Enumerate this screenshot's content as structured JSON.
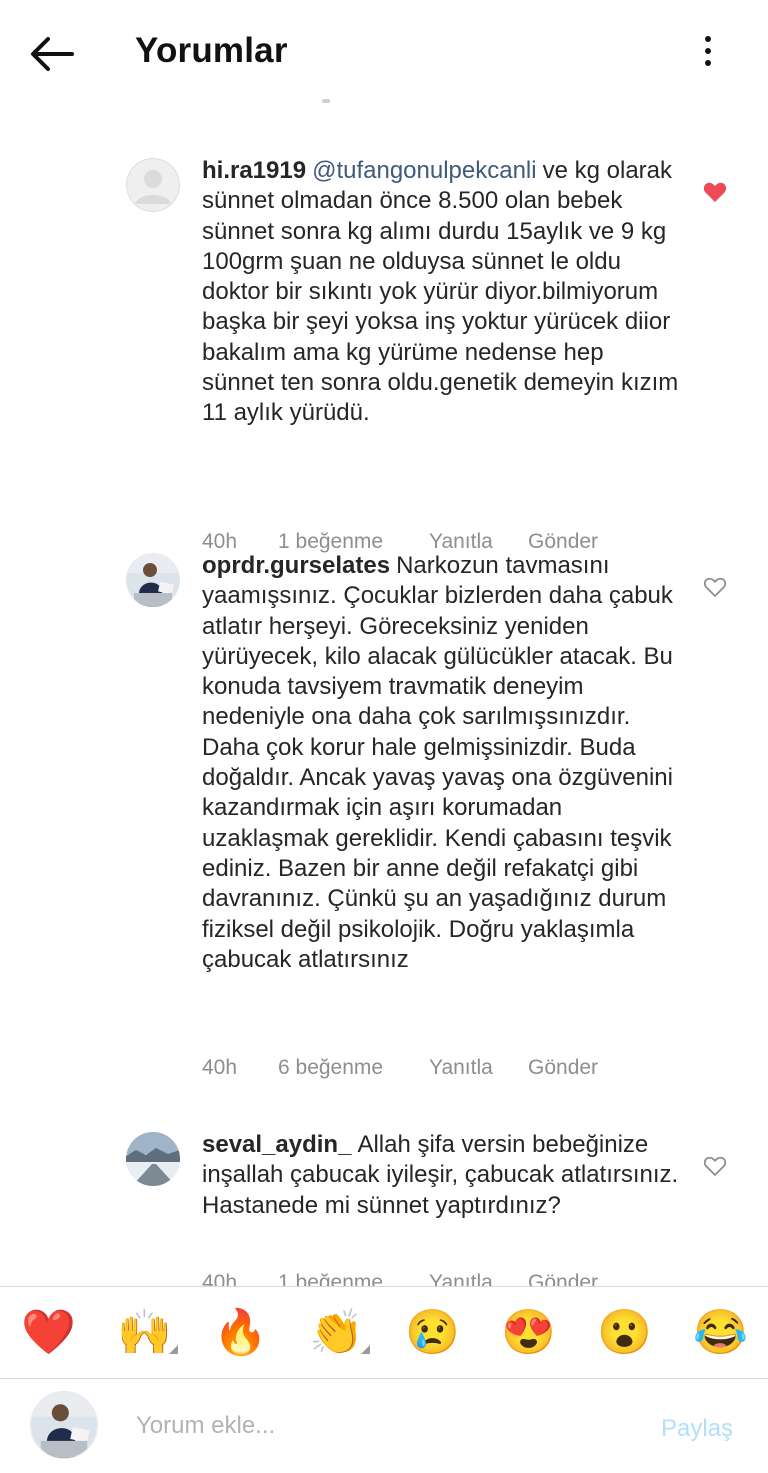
{
  "header": {
    "title": "Yorumlar"
  },
  "comments": [
    {
      "username": "hi.ra1919",
      "mention": "@tufangonulpekcanli",
      "text": "ve kg olarak sünnet olmadan önce 8.500 olan bebek sünnet sonra kg alımı durdu 15aylık ve 9 kg 100grm şuan ne olduysa sünnet le oldu doktor bir sıkıntı yok yürür diyor.bilmiyorum başka bir şeyi yoksa inş yoktur yürücek diior bakalım ama kg yürüme nedense hep sünnet ten sonra oldu.genetik demeyin kızım 11 aylık yürüdü.",
      "time": "40h",
      "likes": "1 beğenme",
      "reply_label": "Yanıtla",
      "send_label": "Gönder",
      "liked": true
    },
    {
      "username": "oprdr.gurselates",
      "mention": "",
      "text": "Narkozun tavmasını yaamışsınız. Çocuklar bizlerden daha çabuk atlatır herşeyi. Göreceksiniz yeniden yürüyecek, kilo alacak gülücükler atacak.  Bu konuda tavsiyem travmatik deneyim nedeniyle ona daha çok sarılmışsınızdır. Daha çok korur hale gelmişsinizdir. Buda doğaldır. Ancak yavaş yavaş ona özgüvenini kazandırmak için aşırı korumadan uzaklaşmak gereklidir. Kendi çabasını teşvik ediniz. Bazen bir anne değil refakatçi gibi davranınız. Çünkü şu an yaşadığınız durum fiziksel değil psikolojik. Doğru yaklaşımla çabucak atlatırsınız",
      "time": "40h",
      "likes": "6 beğenme",
      "reply_label": "Yanıtla",
      "send_label": "Gönder",
      "liked": false
    },
    {
      "username": "seval_aydin_",
      "mention": "",
      "text": "Allah şifa versin bebeğinize inşallah çabucak iyileşir, çabucak atlatırsınız. Hastanede mi sünnet yaptırdınız?",
      "time": "40h",
      "likes": "1 beğenme",
      "reply_label": "Yanıtla",
      "send_label": "Gönder",
      "liked": false
    }
  ],
  "quick_reactions": [
    "❤️",
    "🙌",
    "🔥",
    "👏",
    "😢",
    "😍",
    "😮",
    "😂"
  ],
  "input": {
    "placeholder": "Yorum ekle...",
    "share_label": "Paylaş"
  },
  "colors": {
    "like_red": "#ed4956",
    "mention_blue": "#3e5a7d",
    "meta_gray": "#8e8e8e",
    "share_disabled": "#b2dffc"
  },
  "icons": [
    "back-arrow-icon",
    "more-options-icon",
    "heart-icon",
    "heart-outline-icon"
  ]
}
